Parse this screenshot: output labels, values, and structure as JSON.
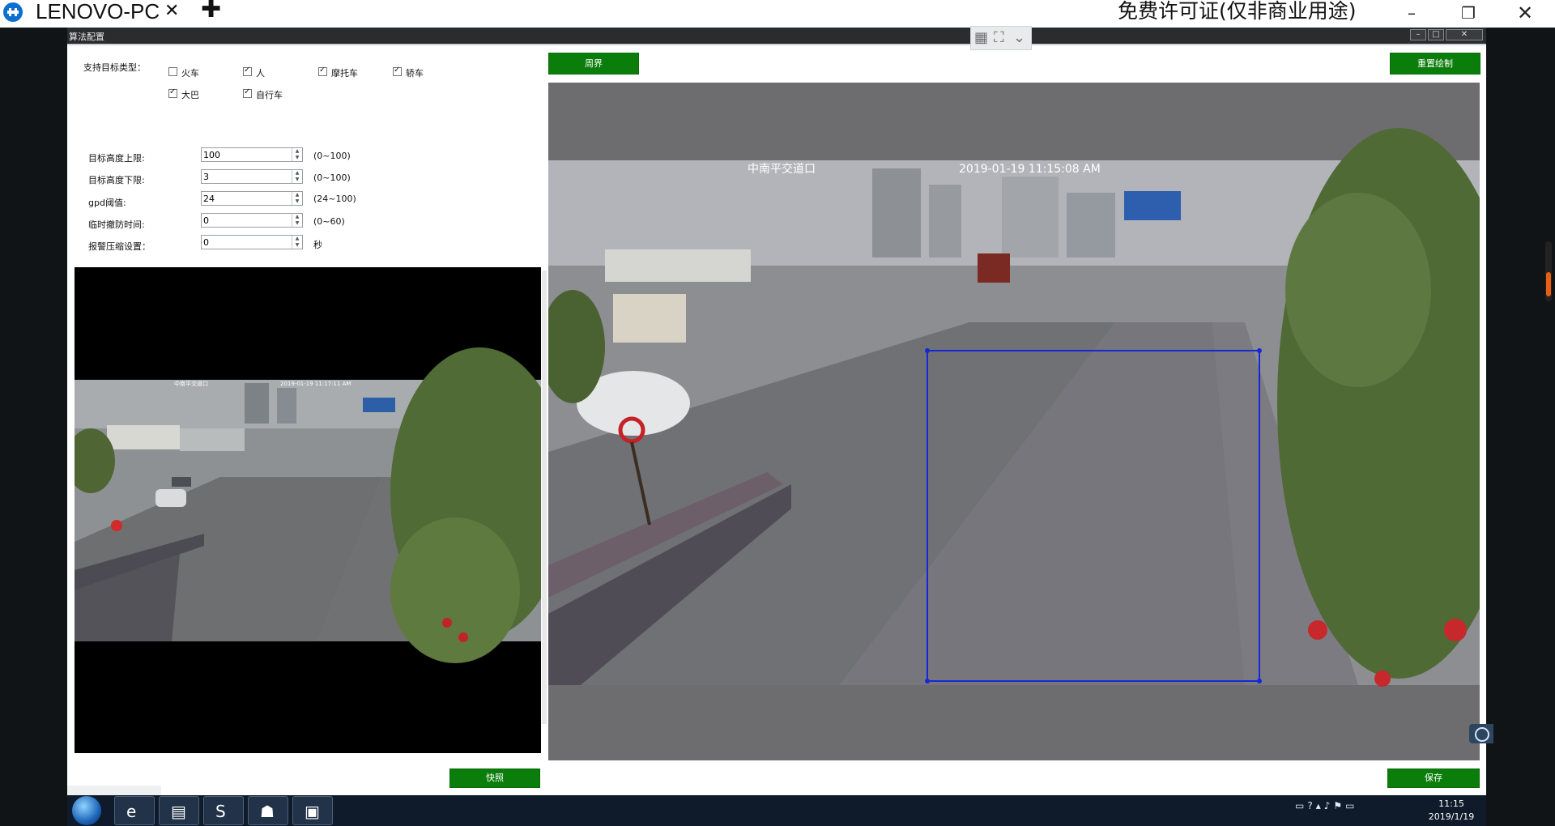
{
  "session_bar": {
    "tab_title": "LENOVO-PC",
    "tab_close": "✕",
    "add_tab": "✚",
    "license_text": "免费许可证(仅非商业用途)",
    "minimize": "–",
    "restore": "❐",
    "close": "✕"
  },
  "app": {
    "title": "算法配置",
    "controls": [
      "–",
      "□",
      "✕"
    ]
  },
  "target_types": {
    "label": "支持目标类型：",
    "options": [
      {
        "label": "火车",
        "checked": false
      },
      {
        "label": "人",
        "checked": true
      },
      {
        "label": "摩托车",
        "checked": true
      },
      {
        "label": "轿车",
        "checked": true
      },
      {
        "label": "大巴",
        "checked": true
      },
      {
        "label": "自行车",
        "checked": true
      }
    ]
  },
  "params": [
    {
      "label": "目标高度上限:",
      "value": "100",
      "range": "(0~100)"
    },
    {
      "label": "目标高度下限:",
      "value": "3",
      "range": "(0~100)"
    },
    {
      "label": "gpd阈值:",
      "value": "24",
      "range": "(24~100)"
    },
    {
      "label": "临时撤防时间:",
      "value": "0",
      "range": "(0~60)"
    },
    {
      "label": "报警压缩设置：",
      "value": "0",
      "range": "秒"
    }
  ],
  "buttons": {
    "perimeter": "周界",
    "reset_draw": "重置绘制",
    "snapshot": "快照",
    "save": "保存"
  },
  "video": {
    "left_osd_name": "中南平交道口",
    "left_osd_time": "2019-01-19 11:17:11 AM",
    "right_osd_name": "中南平交道口",
    "right_osd_time": "2019-01-19 11:15:08 AM",
    "roi_color": "#1428d8"
  },
  "taskbar": {
    "time": "11:15",
    "date": "2019/1/19",
    "apps": [
      "ie-icon",
      "winrar-icon",
      "sogou-icon",
      "network-icon",
      "window-icon"
    ]
  },
  "colors": {
    "accent_green": "#0b7d0b",
    "session_accent": "#0e6fd0"
  }
}
